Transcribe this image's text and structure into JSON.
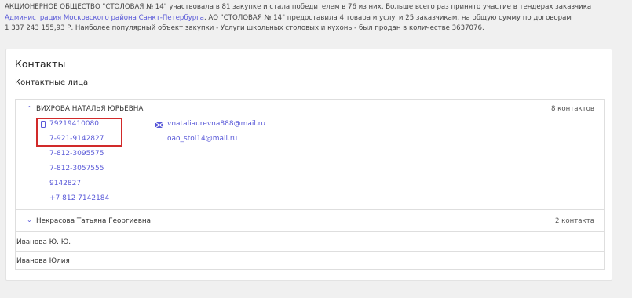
{
  "intro": {
    "text1": "АКЦИОНЕРНОЕ ОБЩЕСТВО \"СТОЛОВАЯ № 14\" участвовала в 81 закупке и стала победителем в 76 из них. Больше всего раз принято участие в тендерах заказчика",
    "link": "Администрация Московского района Санкт-Петербурга",
    "text2": ". АО \"СТОЛОВАЯ № 14\" предоставила 4 товара и услуги 25 заказчикам, на общую сумму по договорам",
    "text3": "1 337 243 155,93 Р. Наиболее популярный объект закупки - Услуги школьных столовых и кухонь - был продан в количестве 3637076."
  },
  "contacts": {
    "title": "Контакты",
    "subtitle": "Контактные лица",
    "persons": [
      {
        "name": "ВИХРОВА НАТАЛЬЯ ЮРЬЕВНА",
        "count": "8 контактов",
        "expanded": true,
        "phones": [
          "79219410080",
          "7-921-9142827",
          "7-812-3095575",
          "7-812-3057555",
          "9142827",
          "+7 812 7142184"
        ],
        "emails": [
          "vnataliaurevna888@mail.ru",
          "oao_stol14@mail.ru"
        ]
      },
      {
        "name": "Некрасова Татьяна Георгиевна",
        "count": "2 контакта",
        "expanded": false
      },
      {
        "name": "Иванова Ю. Ю."
      },
      {
        "name": "Иванова Юлия"
      }
    ]
  },
  "colors": {
    "link": "#5858d8",
    "highlight": "#d12a2a"
  },
  "icons": {
    "phone": "phone-icon",
    "mail": "mail-icon",
    "chevron_up": "chevron-up-icon",
    "chevron_down": "chevron-down-icon"
  }
}
